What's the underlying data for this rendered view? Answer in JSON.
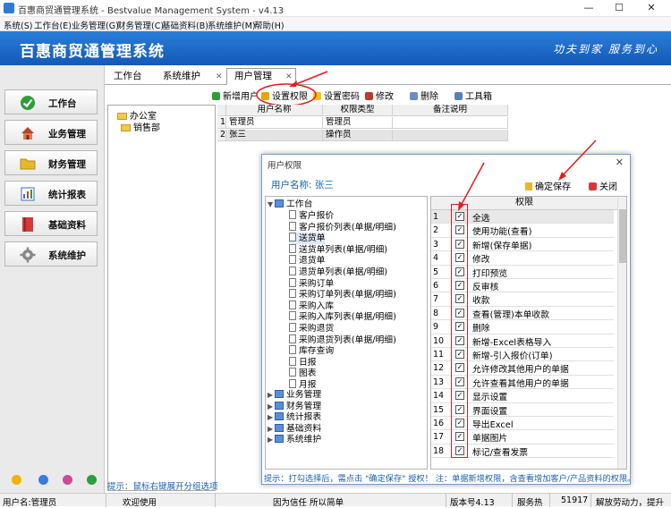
{
  "window": {
    "title": "百惠商贸通管理系统 - Bestvalue Management System - v4.13",
    "minimize": "—",
    "maximize": "☐",
    "close": "✕"
  },
  "menu": [
    "系统(S)",
    "工作台(E)",
    "业务管理(G)",
    "财务管理(C)",
    "基础资料(B)",
    "系统维护(M)",
    "帮助(H)"
  ],
  "banner": {
    "title": "百惠商贸通管理系统",
    "slogan": "功夫到家 服务到心"
  },
  "nav": [
    {
      "label": "工作台",
      "icon": "check-circle-icon",
      "color": "#2e9d3a"
    },
    {
      "label": "业务管理",
      "icon": "home-icon",
      "color": "#b5452f"
    },
    {
      "label": "财务管理",
      "icon": "folder-icon",
      "color": "#e8b730"
    },
    {
      "label": "统计报表",
      "icon": "report-icon",
      "color": "#3a6fc4"
    },
    {
      "label": "基础资料",
      "icon": "book-icon",
      "color": "#d23a3a"
    },
    {
      "label": "系统维护",
      "icon": "gear-icon",
      "color": "#777777"
    }
  ],
  "tabs": [
    {
      "label": "工作台"
    },
    {
      "label": "系统维护"
    },
    {
      "label": "用户管理",
      "active": true
    }
  ],
  "toolbar": [
    "新增用户",
    "设置权限",
    "设置密码",
    "修改",
    "删除",
    "工具箱"
  ],
  "departments": [
    "办公室",
    "销售部"
  ],
  "left_hint": "提示：鼠标右键展开分组选项",
  "users": {
    "headers": [
      "用户名称",
      "权限类型",
      "备注说明"
    ],
    "rows": [
      {
        "no": "1",
        "name": "管理员",
        "type": "管理员",
        "note": ""
      },
      {
        "no": "2",
        "name": "张三",
        "type": "操作员",
        "note": ""
      }
    ]
  },
  "dialog": {
    "title": "用户权限",
    "user_label": "用户名称: 张三",
    "save": "确定保存",
    "close": "关闭",
    "root": "工作台",
    "items": [
      "客户报价",
      "客户报价列表(单据/明细)",
      "送货单",
      "送货单列表(单据/明细)",
      "退货单",
      "退货单列表(单据/明细)",
      "采购订单",
      "采购订单列表(单据/明细)",
      "采购入库",
      "采购入库列表(单据/明细)",
      "采购退货",
      "采购退货列表(单据/明细)",
      "库存查询",
      "日报",
      "图表",
      "月报"
    ],
    "groups": [
      "业务管理",
      "财务管理",
      "统计报表",
      "基础资料",
      "系统维护"
    ],
    "perm_header": "权限",
    "permissions": [
      {
        "no": "1",
        "label": "全选"
      },
      {
        "no": "2",
        "label": "使用功能(查看)"
      },
      {
        "no": "3",
        "label": "新增(保存单据)"
      },
      {
        "no": "4",
        "label": "修改"
      },
      {
        "no": "5",
        "label": "打印预览"
      },
      {
        "no": "6",
        "label": "反审核"
      },
      {
        "no": "7",
        "label": "收款"
      },
      {
        "no": "8",
        "label": "查看(管理)本单收款"
      },
      {
        "no": "9",
        "label": "删除"
      },
      {
        "no": "10",
        "label": "新增-Excel表格导入"
      },
      {
        "no": "11",
        "label": "新增-引入报价(订单)"
      },
      {
        "no": "12",
        "label": "允许修改其他用户的单据"
      },
      {
        "no": "13",
        "label": "允许查看其他用户的单据"
      },
      {
        "no": "14",
        "label": "显示设置"
      },
      {
        "no": "15",
        "label": "界面设置"
      },
      {
        "no": "16",
        "label": "导出Excel"
      },
      {
        "no": "17",
        "label": "单据图片"
      },
      {
        "no": "18",
        "label": "标记/查看发票"
      }
    ],
    "checked_mark": "✓",
    "footer": "提示：打勾选择后，需点击 \"确定保存\" 授权！ 注：单据新增权限，含查看增加客户/产品资料的权限。"
  },
  "status": {
    "user": "用户名:管理员",
    "welcome": "欢迎使用",
    "motto": "因为信任 所以简单",
    "version": "版本号4.13",
    "service": "服务热",
    "phone": "51917",
    "slogan": "解放劳动力，提升"
  }
}
